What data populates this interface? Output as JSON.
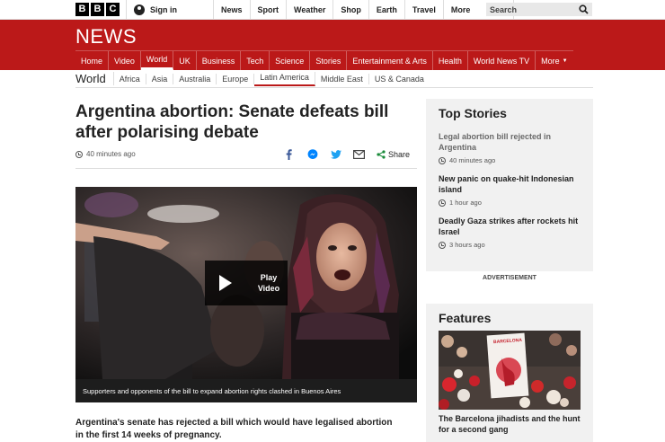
{
  "brand": {
    "logo_letters": [
      "B",
      "B",
      "C"
    ],
    "news": "NEWS"
  },
  "topbar": {
    "signin": "Sign in",
    "nav": [
      "News",
      "Sport",
      "Weather",
      "Shop",
      "Earth",
      "Travel"
    ],
    "more": "More",
    "search_placeholder": "Search"
  },
  "mainnav": [
    "Home",
    "Video",
    "World",
    "UK",
    "Business",
    "Tech",
    "Science",
    "Stories",
    "Entertainment & Arts",
    "Health",
    "World News TV",
    "More"
  ],
  "mainnav_active": "World",
  "subnav": {
    "section": "World",
    "items": [
      "Africa",
      "Asia",
      "Australia",
      "Europe",
      "Latin America",
      "Middle East",
      "US & Canada"
    ],
    "active": "Latin America"
  },
  "article": {
    "headline": "Argentina abortion: Senate defeats bill after polarising debate",
    "timestamp": "40 minutes ago",
    "share_label": "Share",
    "play_label": "Play Video",
    "caption": "Supporters and opponents of the bill to expand abortion rights clashed in Buenos Aires",
    "lede": "Argentina's senate has rejected a bill which would have legalised abortion in the first 14 weeks of pregnancy."
  },
  "top_stories": {
    "title": "Top Stories",
    "items": [
      {
        "title": "Legal abortion bill rejected in Argentina",
        "time": "40 minutes ago"
      },
      {
        "title": "New panic on quake-hit Indonesian island",
        "time": "1 hour ago"
      },
      {
        "title": "Deadly Gaza strikes after rockets hit Israel",
        "time": "3 hours ago"
      }
    ]
  },
  "advertisement": "ADVERTISEMENT",
  "features": {
    "title": "Features",
    "items": [
      {
        "title": "The Barcelona jihadists and the hunt for a second gang",
        "sign_text": "BARCELONA"
      }
    ]
  },
  "colors": {
    "brand_red": "#bb1919",
    "sidebar_bg": "#f1f1f1"
  }
}
